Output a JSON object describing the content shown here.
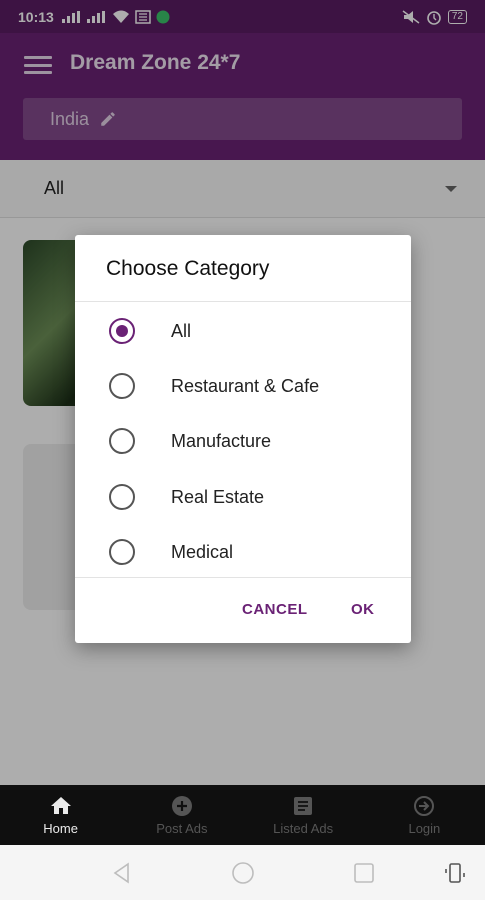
{
  "status_bar": {
    "time": "10:13",
    "battery": "72"
  },
  "app_bar": {
    "title": "Dream Zone 24*7",
    "location": "India"
  },
  "filter": {
    "selected": "All"
  },
  "dialog": {
    "title": "Choose Category",
    "options": [
      {
        "label": "All",
        "selected": true
      },
      {
        "label": "Restaurant & Cafe",
        "selected": false
      },
      {
        "label": "Manufacture",
        "selected": false
      },
      {
        "label": "Real Estate",
        "selected": false
      },
      {
        "label": "Medical",
        "selected": false
      }
    ],
    "cancel_label": "CANCEL",
    "ok_label": "OK"
  },
  "bottom_nav": {
    "items": [
      {
        "label": "Home",
        "icon": "home-icon",
        "active": true
      },
      {
        "label": "Post Ads",
        "icon": "add-circle-icon",
        "active": false
      },
      {
        "label": "Listed Ads",
        "icon": "list-icon",
        "active": false
      },
      {
        "label": "Login",
        "icon": "login-icon",
        "active": false
      }
    ]
  },
  "colors": {
    "primary": "#6a2275",
    "status_bar": "#5a1c63",
    "accent": "#6a2275"
  }
}
